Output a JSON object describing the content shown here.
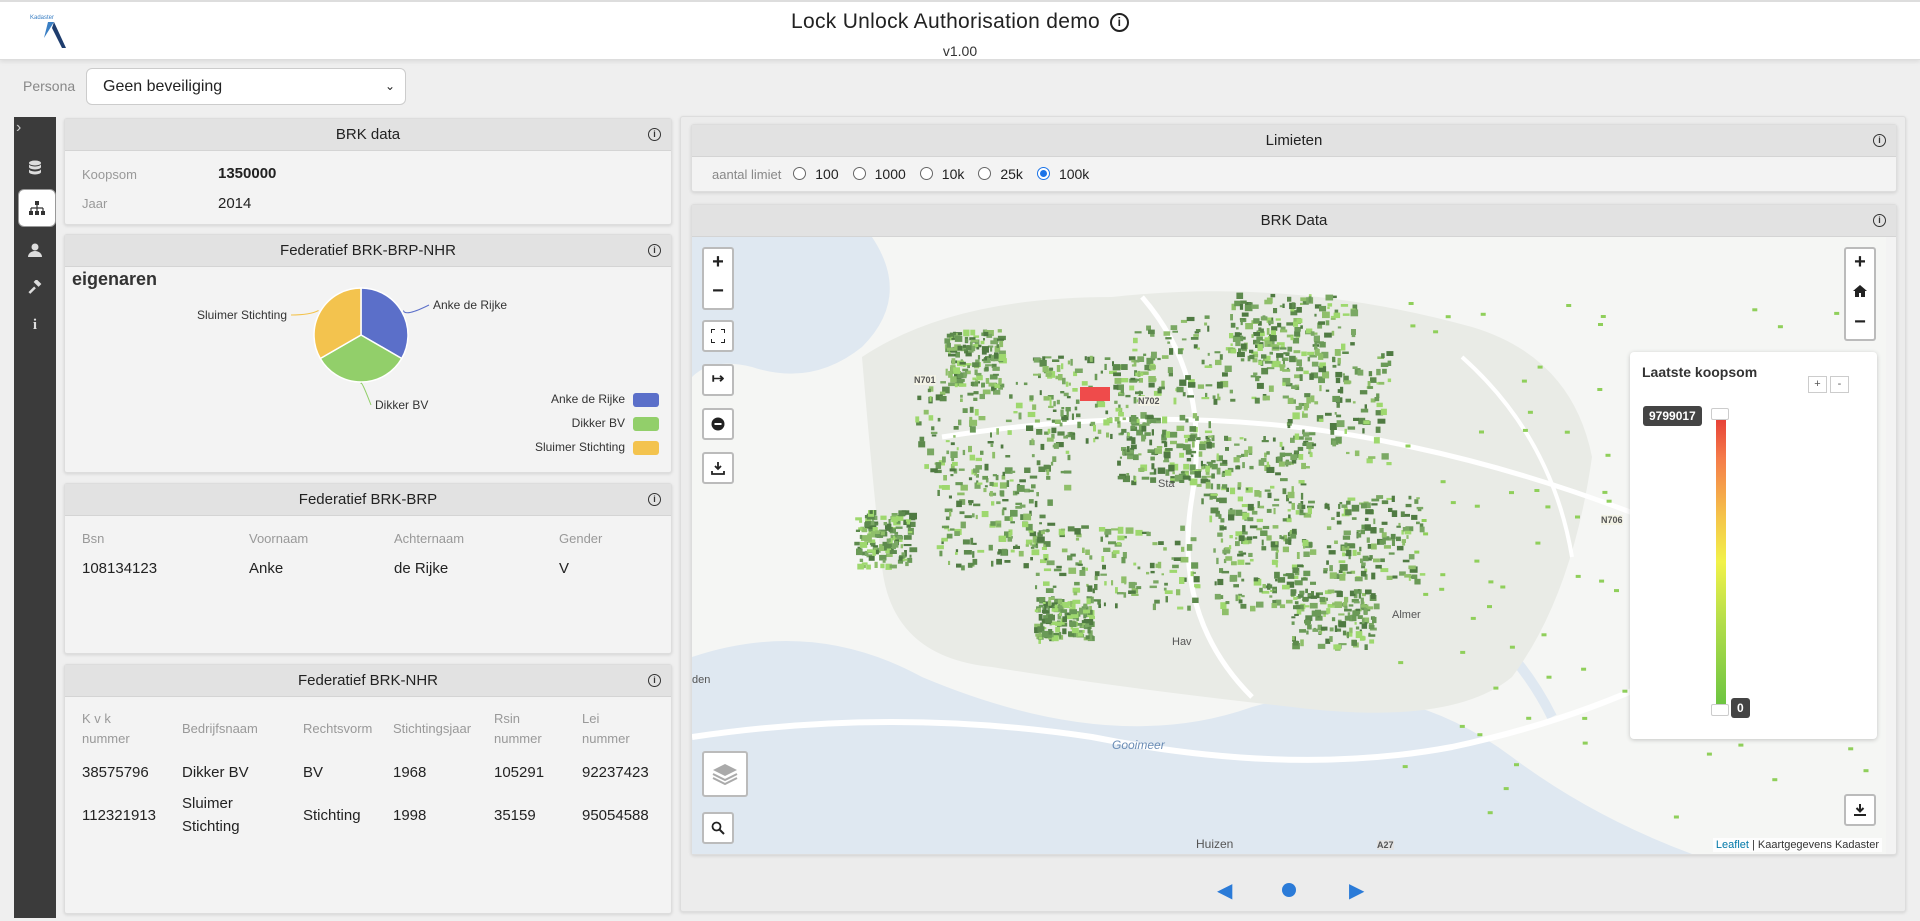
{
  "header": {
    "title": "Lock Unlock Authorisation demo",
    "version": "v1.00",
    "logo_text": "Kadaster"
  },
  "persona": {
    "label": "Persona",
    "selected": "Geen beveiliging"
  },
  "sidebar": {
    "items": [
      {
        "icon": "database-icon"
      },
      {
        "icon": "sitemap-icon",
        "active": true
      },
      {
        "icon": "user-icon"
      },
      {
        "icon": "gavel-icon"
      },
      {
        "icon": "info-icon"
      }
    ]
  },
  "brk_data": {
    "title": "BRK data",
    "koopsom_label": "Koopsom",
    "koopsom_value": "1350000",
    "jaar_label": "Jaar",
    "jaar_value": "2014"
  },
  "fed_brp_nhr": {
    "title": "Federatief BRK-BRP-NHR",
    "subtitle": "eigenaren",
    "legend": [
      {
        "name": "Anke de Rijke",
        "color": "#5b6fc9"
      },
      {
        "name": "Dikker BV",
        "color": "#92cf6a"
      },
      {
        "name": "Sluimer Stichting",
        "color": "#f3c34e"
      }
    ],
    "chart_data": {
      "type": "pie",
      "title": "eigenaren",
      "labels": [
        "Anke de Rijke",
        "Dikker BV",
        "Sluimer Stichting"
      ],
      "values": [
        1,
        1,
        1
      ],
      "legend": "bottom-right"
    }
  },
  "fed_brp": {
    "title": "Federatief BRK-BRP",
    "headers": [
      "Bsn",
      "Voornaam",
      "Achternaam",
      "Gender"
    ],
    "rows": [
      [
        "108134123",
        "Anke",
        "de Rijke",
        "V"
      ]
    ]
  },
  "fed_nhr": {
    "title": "Federatief BRK-NHR",
    "headers": [
      "K v k nummer",
      "Bedrijfsnaam",
      "Rechtsvorm",
      "Stichtingsjaar",
      "Rsin nummer",
      "Lei nummer"
    ],
    "rows": [
      [
        "38575796",
        "Dikker BV",
        "BV",
        "1968",
        "105291",
        "92237423"
      ],
      [
        "112321913",
        "Sluimer Stichting",
        "Stichting",
        "1998",
        "35159",
        "95054588"
      ]
    ]
  },
  "limieten": {
    "title": "Limieten",
    "label": "aantal limiet",
    "options": [
      "100",
      "1000",
      "10k",
      "25k",
      "100k"
    ],
    "selected": "100k"
  },
  "map": {
    "title": "BRK Data",
    "legend_title": "Laatste koopsom",
    "max_value": "9799017",
    "min_value": "0",
    "labels": {
      "n701": "N701",
      "n702": "N702",
      "n706": "N706",
      "a27": "A27",
      "gooimeer": "Gooimeer",
      "huizen": "Huizen",
      "den": "den",
      "almere": "Almer",
      "haven": "Hav",
      "stad": "Sta"
    },
    "attribution_link": "Leaflet",
    "attribution_text": " | Kaartgegevens Kadaster"
  }
}
